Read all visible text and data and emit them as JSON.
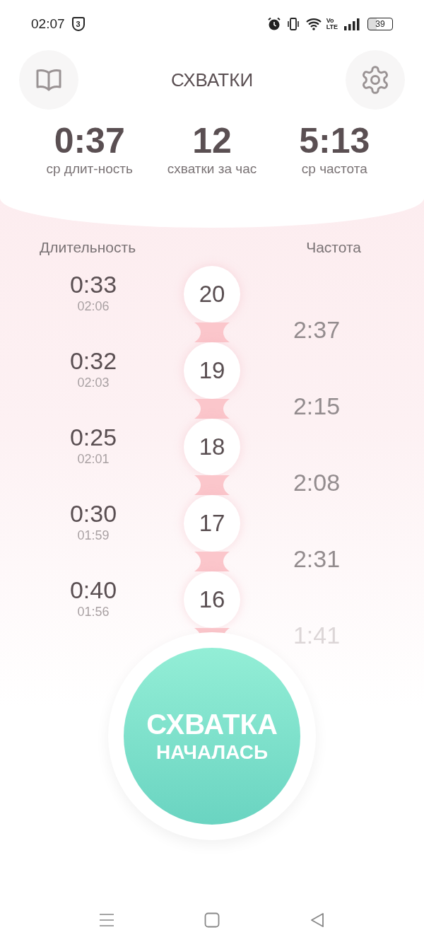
{
  "status_bar": {
    "time": "02:07",
    "shield_badge": "3",
    "volte_top": "Vo",
    "volte_bottom": "LTE",
    "battery": "39"
  },
  "header": {
    "title": "СХВАТКИ"
  },
  "stats": [
    {
      "value": "0:37",
      "label": "ср длит-ность"
    },
    {
      "value": "12",
      "label": "схватки за час"
    },
    {
      "value": "5:13",
      "label": "ср частота"
    }
  ],
  "columns": {
    "duration": "Длительность",
    "frequency": "Частота"
  },
  "contractions": [
    {
      "duration": "0:33",
      "start": "02:06",
      "number": "20",
      "frequency": "2:37"
    },
    {
      "duration": "0:32",
      "start": "02:03",
      "number": "19",
      "frequency": "2:15"
    },
    {
      "duration": "0:25",
      "start": "02:01",
      "number": "18",
      "frequency": "2:08"
    },
    {
      "duration": "0:30",
      "start": "01:59",
      "number": "17",
      "frequency": "2:31"
    },
    {
      "duration": "0:40",
      "start": "01:56",
      "number": "16",
      "frequency": "1:41"
    }
  ],
  "start_button": {
    "line_1": "СХВАТКА",
    "line_2": "НАЧАЛАСЬ"
  }
}
